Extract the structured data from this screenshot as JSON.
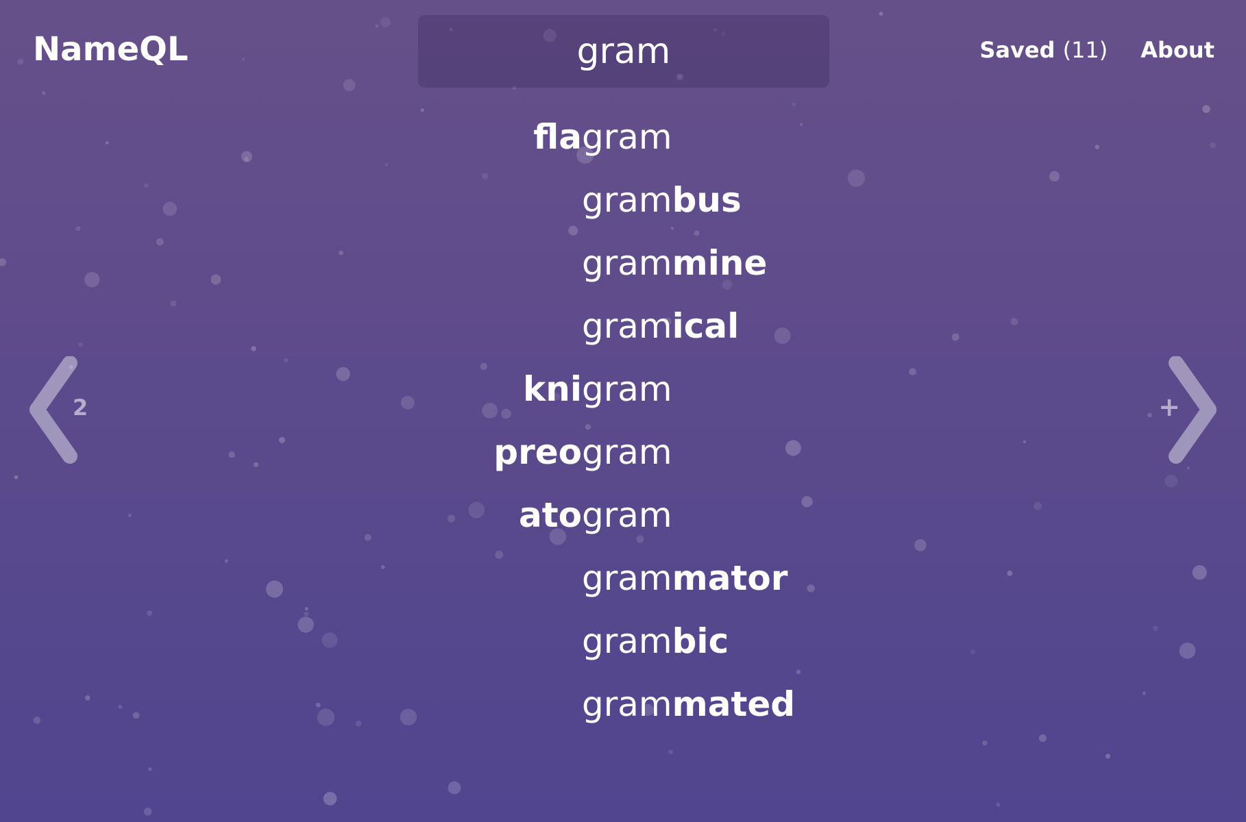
{
  "app": {
    "title": "NameQL"
  },
  "search": {
    "value": "gram",
    "placeholder": ""
  },
  "nav": {
    "saved_label": "Saved",
    "saved_count": "(11)",
    "about_label": "About"
  },
  "pagination": {
    "prev_page": "2",
    "next_symbol": "+"
  },
  "results": [
    {
      "prefix": "fla",
      "suffix": ""
    },
    {
      "prefix": "",
      "suffix": "bus"
    },
    {
      "prefix": "",
      "suffix": "mine"
    },
    {
      "prefix": "",
      "suffix": "ical"
    },
    {
      "prefix": "kni",
      "suffix": ""
    },
    {
      "prefix": "preo",
      "suffix": ""
    },
    {
      "prefix": "ato",
      "suffix": ""
    },
    {
      "prefix": "",
      "suffix": "mator"
    },
    {
      "prefix": "",
      "suffix": "bic"
    },
    {
      "prefix": "",
      "suffix": "mated"
    }
  ],
  "colors": {
    "background_top": "#66508a",
    "background_bottom": "#51458f",
    "text": "#ffffff"
  },
  "icons": {
    "prev": "chevron-left-icon",
    "next": "chevron-right-icon"
  }
}
